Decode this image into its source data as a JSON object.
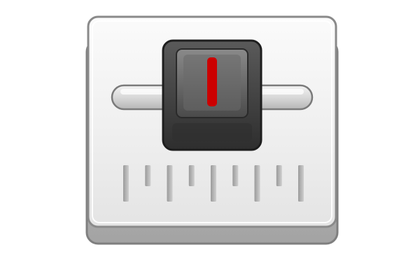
{
  "icon": {
    "semantic": "slider-control-icon",
    "description_id": "settings-slider-icon"
  },
  "slider": {
    "value": 0.5,
    "indicator_color": "#cc0000"
  },
  "scale": {
    "tick_count": 9
  },
  "colors": {
    "panel_light": "#f7f7f7",
    "panel_mid": "#e6e6e6",
    "panel_border": "#8a8a8a",
    "knob_dark": "#3a3a3a",
    "knob_border": "#1e1e1e",
    "track": "#d9d9d9",
    "indicator": "#cc0000"
  }
}
